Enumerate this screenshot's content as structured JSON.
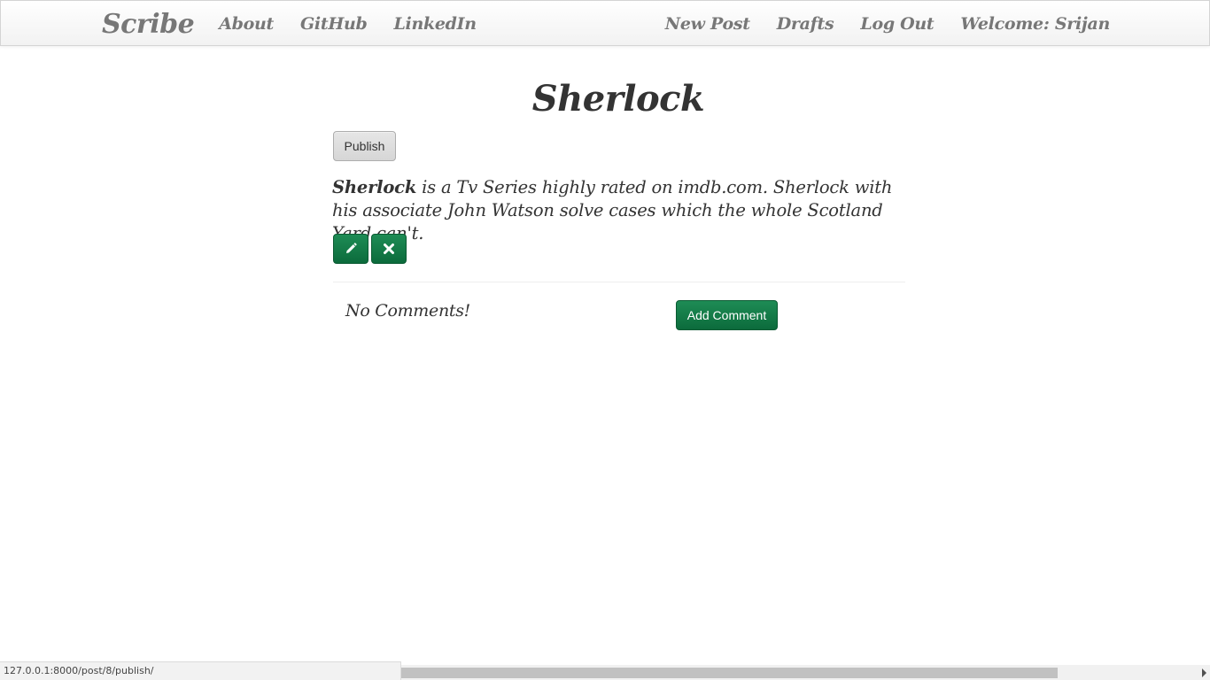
{
  "navbar": {
    "brand": "Scribe",
    "left_links": [
      "About",
      "GitHub",
      "LinkedIn"
    ],
    "right_links": [
      "New Post",
      "Drafts",
      "Log Out"
    ],
    "welcome": "Welcome: Srijan"
  },
  "post": {
    "title": "Sherlock",
    "publish_label": "Publish",
    "body_strong": "Sherlock",
    "body_rest": " is a Tv Series highly rated on imdb.com. Sherlock with his associate John Watson solve cases which the whole Scotland Yard can't.",
    "edit_icon": "pencil-icon",
    "delete_icon": "close-icon"
  },
  "comments": {
    "empty_text": "No Comments!",
    "add_label": "Add Comment"
  },
  "status_bar": {
    "url": "127.0.0.1:8000/post/8/publish/"
  },
  "colors": {
    "accent_green": "#0c6b3c",
    "nav_text": "#777777",
    "text": "#333333"
  }
}
